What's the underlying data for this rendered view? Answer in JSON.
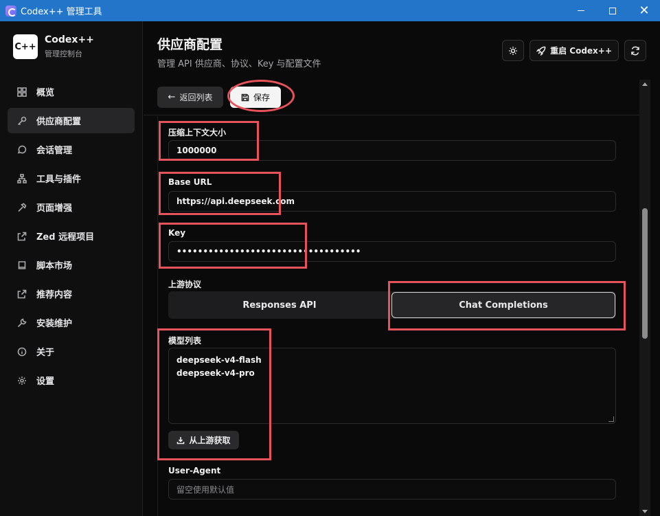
{
  "window": {
    "title": "Codex++ 管理工具"
  },
  "brand": {
    "logo": "C++",
    "name": "Codex++",
    "subtitle": "管理控制台"
  },
  "sidebar": {
    "items": [
      {
        "label": "概览",
        "icon": "dashboard-icon"
      },
      {
        "label": "供应商配置",
        "icon": "key-icon",
        "active": true
      },
      {
        "label": "会话管理",
        "icon": "chat-icon"
      },
      {
        "label": "工具与插件",
        "icon": "network-icon"
      },
      {
        "label": "页面增强",
        "icon": "hammer-icon"
      },
      {
        "label": "Zed 远程项目",
        "icon": "external-link-icon"
      },
      {
        "label": "脚本市场",
        "icon": "book-icon"
      },
      {
        "label": "推荐内容",
        "icon": "external-link-icon"
      },
      {
        "label": "安装维护",
        "icon": "wrench-icon"
      },
      {
        "label": "关于",
        "icon": "info-icon"
      },
      {
        "label": "设置",
        "icon": "gear-icon"
      }
    ]
  },
  "header": {
    "title": "供应商配置",
    "subtitle": "管理 API 供应商、协议、Key 与配置文件",
    "restart_label": "重启 Codex++"
  },
  "toolbar": {
    "back_label": "返回列表",
    "save_label": "保存"
  },
  "form": {
    "compress_label": "压缩上下文大小",
    "compress_value": "1000000",
    "base_url_label": "Base URL",
    "base_url_value": "https://api.deepseek.com",
    "key_label": "Key",
    "key_value": "•••••••••••••••••••••••••••••••••••",
    "protocol_label": "上游协议",
    "protocol_options": [
      "Responses API",
      "Chat Completions"
    ],
    "protocol_selected": "Chat Completions",
    "models_label": "模型列表",
    "models": [
      "deepseek-v4-flash",
      "deepseek-v4-pro"
    ],
    "fetch_label": "从上游获取",
    "ua_label": "User-Agent",
    "ua_placeholder": "留空使用默认值"
  },
  "colors": {
    "accent_titlebar": "#2375c9",
    "annotation": "#e7535a"
  }
}
